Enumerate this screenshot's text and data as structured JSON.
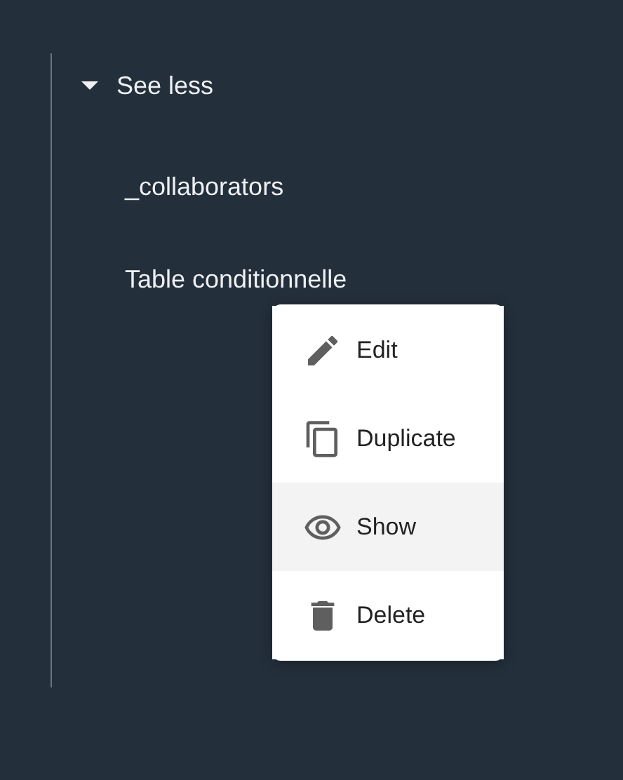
{
  "tree": {
    "toggle": {
      "label": "See less",
      "expanded": true
    },
    "items": [
      {
        "label": "_collaborators"
      },
      {
        "label": "Table conditionnelle"
      }
    ]
  },
  "context_menu": {
    "items": [
      {
        "kind": "edit",
        "label": "Edit",
        "highlighted": false
      },
      {
        "kind": "duplicate",
        "label": "Duplicate",
        "highlighted": false
      },
      {
        "kind": "show",
        "label": "Show",
        "highlighted": true
      },
      {
        "kind": "delete",
        "label": "Delete",
        "highlighted": false
      }
    ]
  }
}
